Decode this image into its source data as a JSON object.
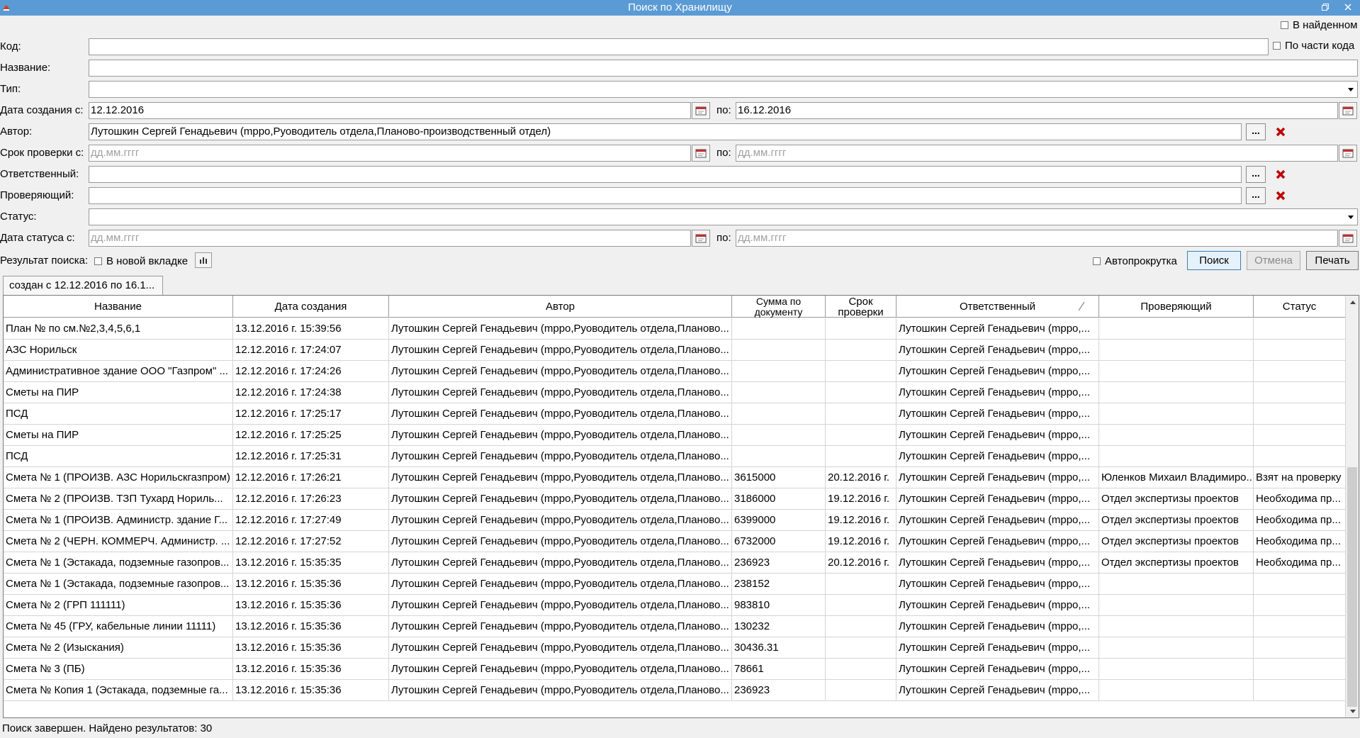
{
  "window": {
    "title": "Поиск по Хранилищу"
  },
  "form": {
    "in_found_label": "В найденном",
    "code_label": "Код:",
    "code_value": "",
    "by_code_part_label": "По части кода",
    "name_label": "Название:",
    "name_value": "",
    "type_label": "Тип:",
    "type_value": "",
    "created_from_label": "Дата создания с:",
    "created_from_value": "12.12.2016",
    "to_label": "по:",
    "created_to_value": "16.12.2016",
    "author_label": "Автор:",
    "author_value": "Лутошкин Сергей Генадьевич (mppo,Руоводитель отдела,Планово-производственный отдел)",
    "check_from_label": "Срок проверки с:",
    "date_placeholder": "дд.мм.гггг",
    "responsible_label": "Ответственный:",
    "responsible_value": "",
    "checker_label": "Проверяющий:",
    "checker_value": "",
    "status_label": "Статус:",
    "status_value": "",
    "status_date_label": "Дата статуса с:",
    "result_label": "Результат поиска:",
    "new_tab_label": "В новой вкладке",
    "autoscroll_label": "Автопрокрутка",
    "ellipsis": "...",
    "search_button": "Поиск",
    "cancel_button": "Отмена",
    "print_button": "Печать"
  },
  "results_tab": {
    "label": "создан с 12.12.2016 по 16.1..."
  },
  "table": {
    "headers": {
      "name": "Название",
      "created": "Дата создания",
      "author": "Автор",
      "sum_line1": "Сумма по",
      "sum_line2": "документу",
      "deadline": "Срок проверки",
      "responsible": "Ответственный",
      "checker": "Проверяющий",
      "status": "Статус"
    },
    "rows": [
      [
        "План № по см.№2,3,4,5,6,1",
        "13.12.2016 г. 15:39:56",
        "Лутошкин Сергей Генадьевич (mppo,Руоводитель отдела,Планово...",
        "",
        "",
        "Лутошкин Сергей Генадьевич (mppo,...",
        "",
        ""
      ],
      [
        "АЗС Норильск",
        "12.12.2016 г. 17:24:07",
        "Лутошкин Сергей Генадьевич (mppo,Руоводитель отдела,Планово...",
        "",
        "",
        "Лутошкин Сергей Генадьевич (mppo,...",
        "",
        ""
      ],
      [
        "Административное здание ООО \"Газпром\" ...",
        "12.12.2016 г. 17:24:26",
        "Лутошкин Сергей Генадьевич (mppo,Руоводитель отдела,Планово...",
        "",
        "",
        "Лутошкин Сергей Генадьевич (mppo,...",
        "",
        ""
      ],
      [
        "Сметы на ПИР",
        "12.12.2016 г. 17:24:38",
        "Лутошкин Сергей Генадьевич (mppo,Руоводитель отдела,Планово...",
        "",
        "",
        "Лутошкин Сергей Генадьевич (mppo,...",
        "",
        ""
      ],
      [
        "ПСД",
        "12.12.2016 г. 17:25:17",
        "Лутошкин Сергей Генадьевич (mppo,Руоводитель отдела,Планово...",
        "",
        "",
        "Лутошкин Сергей Генадьевич (mppo,...",
        "",
        ""
      ],
      [
        "Сметы на ПИР",
        "12.12.2016 г. 17:25:25",
        "Лутошкин Сергей Генадьевич (mppo,Руоводитель отдела,Планово...",
        "",
        "",
        "Лутошкин Сергей Генадьевич (mppo,...",
        "",
        ""
      ],
      [
        "ПСД",
        "12.12.2016 г. 17:25:31",
        "Лутошкин Сергей Генадьевич (mppo,Руоводитель отдела,Планово...",
        "",
        "",
        "Лутошкин Сергей Генадьевич (mppo,...",
        "",
        ""
      ],
      [
        "Смета № 1 (ПРОИЗВ. АЗС  Норильскгазпром)",
        "12.12.2016 г. 17:26:21",
        "Лутошкин Сергей Генадьевич (mppo,Руоводитель отдела,Планово...",
        "3615000",
        "20.12.2016 г.",
        "Лутошкин Сергей Генадьевич (mppo,...",
        "Юленков Михаил Владимиро...",
        "Взят на проверку"
      ],
      [
        "Смета № 2 (ПРОИЗВ. ТЗП Тухард  Нориль...",
        "12.12.2016 г. 17:26:23",
        "Лутошкин Сергей Генадьевич (mppo,Руоводитель отдела,Планово...",
        "3186000",
        "19.12.2016 г.",
        "Лутошкин Сергей Генадьевич (mppo,...",
        "Отдел экспертизы проектов",
        "Необходима пр..."
      ],
      [
        "Смета № 1 (ПРОИЗВ. Администр. здание  Г...",
        "12.12.2016 г. 17:27:49",
        "Лутошкин Сергей Генадьевич (mppo,Руоводитель отдела,Планово...",
        "6399000",
        "19.12.2016 г.",
        "Лутошкин Сергей Генадьевич (mppo,...",
        "Отдел экспертизы проектов",
        "Необходима пр..."
      ],
      [
        "Смета № 2 (ЧЕРН. КОММЕРЧ. Администр. ...",
        "12.12.2016 г. 17:27:52",
        "Лутошкин Сергей Генадьевич (mppo,Руоводитель отдела,Планово...",
        "6732000",
        "19.12.2016 г.",
        "Лутошкин Сергей Генадьевич (mppo,...",
        "Отдел экспертизы проектов",
        "Необходима пр..."
      ],
      [
        "Смета № 1 (Эстакада, подземные газопров...",
        "13.12.2016 г. 15:35:35",
        "Лутошкин Сергей Генадьевич (mppo,Руоводитель отдела,Планово...",
        "236923",
        "20.12.2016 г.",
        "Лутошкин Сергей Генадьевич (mppo,...",
        "Отдел экспертизы проектов",
        "Необходима пр..."
      ],
      [
        "Смета № 1 (Эстакада, подземные газопров...",
        "13.12.2016 г. 15:35:36",
        "Лутошкин Сергей Генадьевич (mppo,Руоводитель отдела,Планово...",
        "238152",
        "",
        "Лутошкин Сергей Генадьевич (mppo,...",
        "",
        ""
      ],
      [
        "Смета № 2 (ГРП 111111)",
        "13.12.2016 г. 15:35:36",
        "Лутошкин Сергей Генадьевич (mppo,Руоводитель отдела,Планово...",
        "983810",
        "",
        "Лутошкин Сергей Генадьевич (mppo,...",
        "",
        ""
      ],
      [
        "Смета № 45 (ГРУ, кабельные линии 11111)",
        "13.12.2016 г. 15:35:36",
        "Лутошкин Сергей Генадьевич (mppo,Руоводитель отдела,Планово...",
        "130232",
        "",
        "Лутошкин Сергей Генадьевич (mppo,...",
        "",
        ""
      ],
      [
        "Смета № 2 (Изыскания)",
        "13.12.2016 г. 15:35:36",
        "Лутошкин Сергей Генадьевич (mppo,Руоводитель отдела,Планово...",
        "30436.31",
        "",
        "Лутошкин Сергей Генадьевич (mppo,...",
        "",
        ""
      ],
      [
        "Смета № 3 (ПБ)",
        "13.12.2016 г. 15:35:36",
        "Лутошкин Сергей Генадьевич (mppo,Руоводитель отдела,Планово...",
        "78661",
        "",
        "Лутошкин Сергей Генадьевич (mppo,...",
        "",
        ""
      ],
      [
        "Смета № Копия 1 (Эстакада, подземные га...",
        "13.12.2016 г. 15:35:36",
        "Лутошкин Сергей Генадьевич (mppo,Руоводитель отдела,Планово...",
        "236923",
        "",
        "Лутошкин Сергей Генадьевич (mppo,...",
        "",
        ""
      ]
    ]
  },
  "status_bar": {
    "text": "Поиск завершен. Найдено результатов: 30"
  },
  "colors": {
    "titlebar": "#5b9bd5",
    "delete_icon": "#c00000"
  }
}
